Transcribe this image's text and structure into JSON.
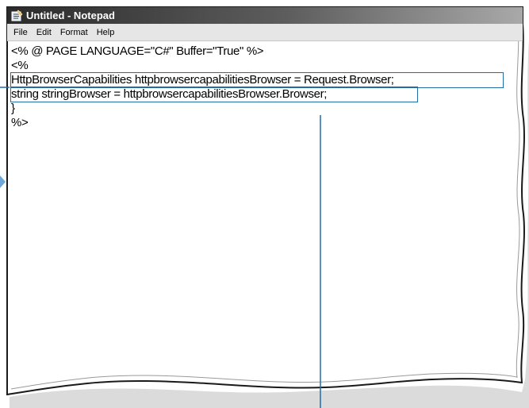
{
  "window": {
    "title": "Untitled - Notepad",
    "app_icon": "notepad-icon"
  },
  "menu": {
    "items": [
      {
        "label": "File"
      },
      {
        "label": "Edit"
      },
      {
        "label": "Format"
      },
      {
        "label": "Help"
      }
    ]
  },
  "editor": {
    "lines": [
      "<% @ PAGE LANGUAGE=\"C#\" Buffer=\"True\" %>",
      "<%",
      "HttpBrowserCapabilities httpbrowsercapabilitiesBrowser = Request.Browser;",
      "string stringBrowser = httpbrowsercapabilitiesBrowser.Browser;",
      "}",
      "%>"
    ],
    "highlighted_lines": [
      2,
      3
    ]
  },
  "colors": {
    "callout_line": "#1f6ea8",
    "callout_arrow": "#6fa8d8",
    "frame_border": "#1a1a1a",
    "page_shadow": "#8a8a8a",
    "menu_background": "#e6e6e6"
  }
}
